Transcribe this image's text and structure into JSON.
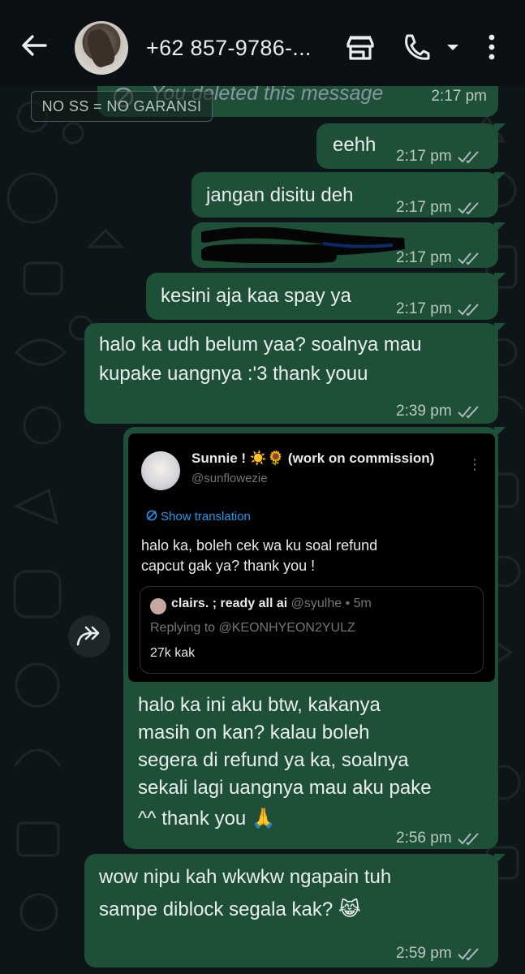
{
  "header": {
    "contact_name": "+62 857-9786-...",
    "icons": [
      "back-arrow-icon",
      "avatar",
      "store-icon",
      "phone-icon",
      "chevron-down-icon",
      "more-vertical-icon"
    ]
  },
  "watermark": "NO SS = NO GARANSI",
  "colors": {
    "bubble_out": "#1e5038",
    "background": "#0b1014",
    "meta_text": "#b9c8c0"
  },
  "messages": [
    {
      "id": "deleted",
      "text": "You deleted this message",
      "time": "2:17 pm",
      "deleted": true
    },
    {
      "id": "m1",
      "text": "eehh",
      "time": "2:17 pm",
      "status": "read"
    },
    {
      "id": "m2",
      "text": "jangan disitu deh",
      "time": "2:17 pm",
      "status": "read"
    },
    {
      "id": "m3",
      "text": "",
      "time": "2:17 pm",
      "status": "read",
      "redacted": true
    },
    {
      "id": "m4",
      "text": "kesini aja kaa spay ya",
      "time": "2:17 pm",
      "status": "read"
    },
    {
      "id": "m5",
      "lines": [
        "halo ka udh belum yaa? soalnya mau",
        "kupake uangnya :'3 thank youu"
      ],
      "time": "2:39 pm",
      "status": "read"
    },
    {
      "id": "m6",
      "lines": [
        "halo ka ini aku btw, kakanya",
        "masih on kan? kalau boleh",
        "segera di refund ya ka, soalnya",
        "sekali lagi uangnya mau aku pake",
        "^^ thank you 🙏"
      ],
      "time": "2:56 pm",
      "status": "read"
    },
    {
      "id": "m7",
      "lines": [
        "wow nipu kah wkwkw ngapain tuh",
        "sampe diblock segala kak? 😹"
      ],
      "time": "2:59 pm",
      "status": "read"
    }
  ],
  "embedded_post": {
    "display_name": "Sunnie ! ☀️🌻 (work on commission)",
    "handle": "@sunflowezie",
    "translate_label": "Show translation",
    "text_lines": [
      "halo ka,  boleh cek wa ku soal refund",
      "capcut gak ya? thank you !"
    ],
    "quote": {
      "name": "clairs. ; ready all ai",
      "handle_time": "@syulhe • 5m",
      "replying": "Replying to @KEONHYEON2YULZ",
      "text": "27k kak"
    }
  }
}
